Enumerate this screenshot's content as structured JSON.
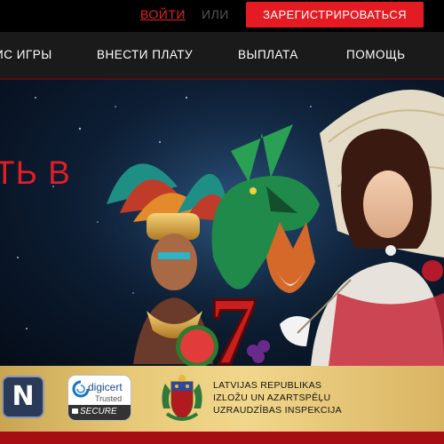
{
  "header": {
    "login_label": "ВОЙТИ",
    "or_label": "ИЛИ",
    "register_label": "ЗАРЕГИСТРИРОВАТЬСЯ"
  },
  "nav": {
    "items": [
      {
        "label": "ИС ИГРЫ"
      },
      {
        "label": "ВНЕСТИ ПЛАТУ"
      },
      {
        "label": "ВЫПЛАТА"
      },
      {
        "label": "ПОМОЩЬ"
      }
    ]
  },
  "hero": {
    "headline_fragment": "ТЬ В",
    "slot_symbol": "7"
  },
  "trust": {
    "novomatic_letter": "N",
    "digicert": {
      "brand": "digicert",
      "trusted": "Trusted",
      "secure": "SECURE"
    },
    "regulator": {
      "line1": "LATVIJAS REPUBLIKAS",
      "line2": "IZLOŽU UN AZARTSPĒĻU",
      "line3": "UZRAUDZĪBAS INSPEKCIJA"
    }
  },
  "colors": {
    "accent_red": "#e51b24",
    "nav_bg": "#1a1a1a",
    "trust_gold": "#e7c977"
  },
  "icons": [
    "novomatic-logo-icon",
    "digicert-lock-icon",
    "latvia-coat-of-arms-icon"
  ]
}
